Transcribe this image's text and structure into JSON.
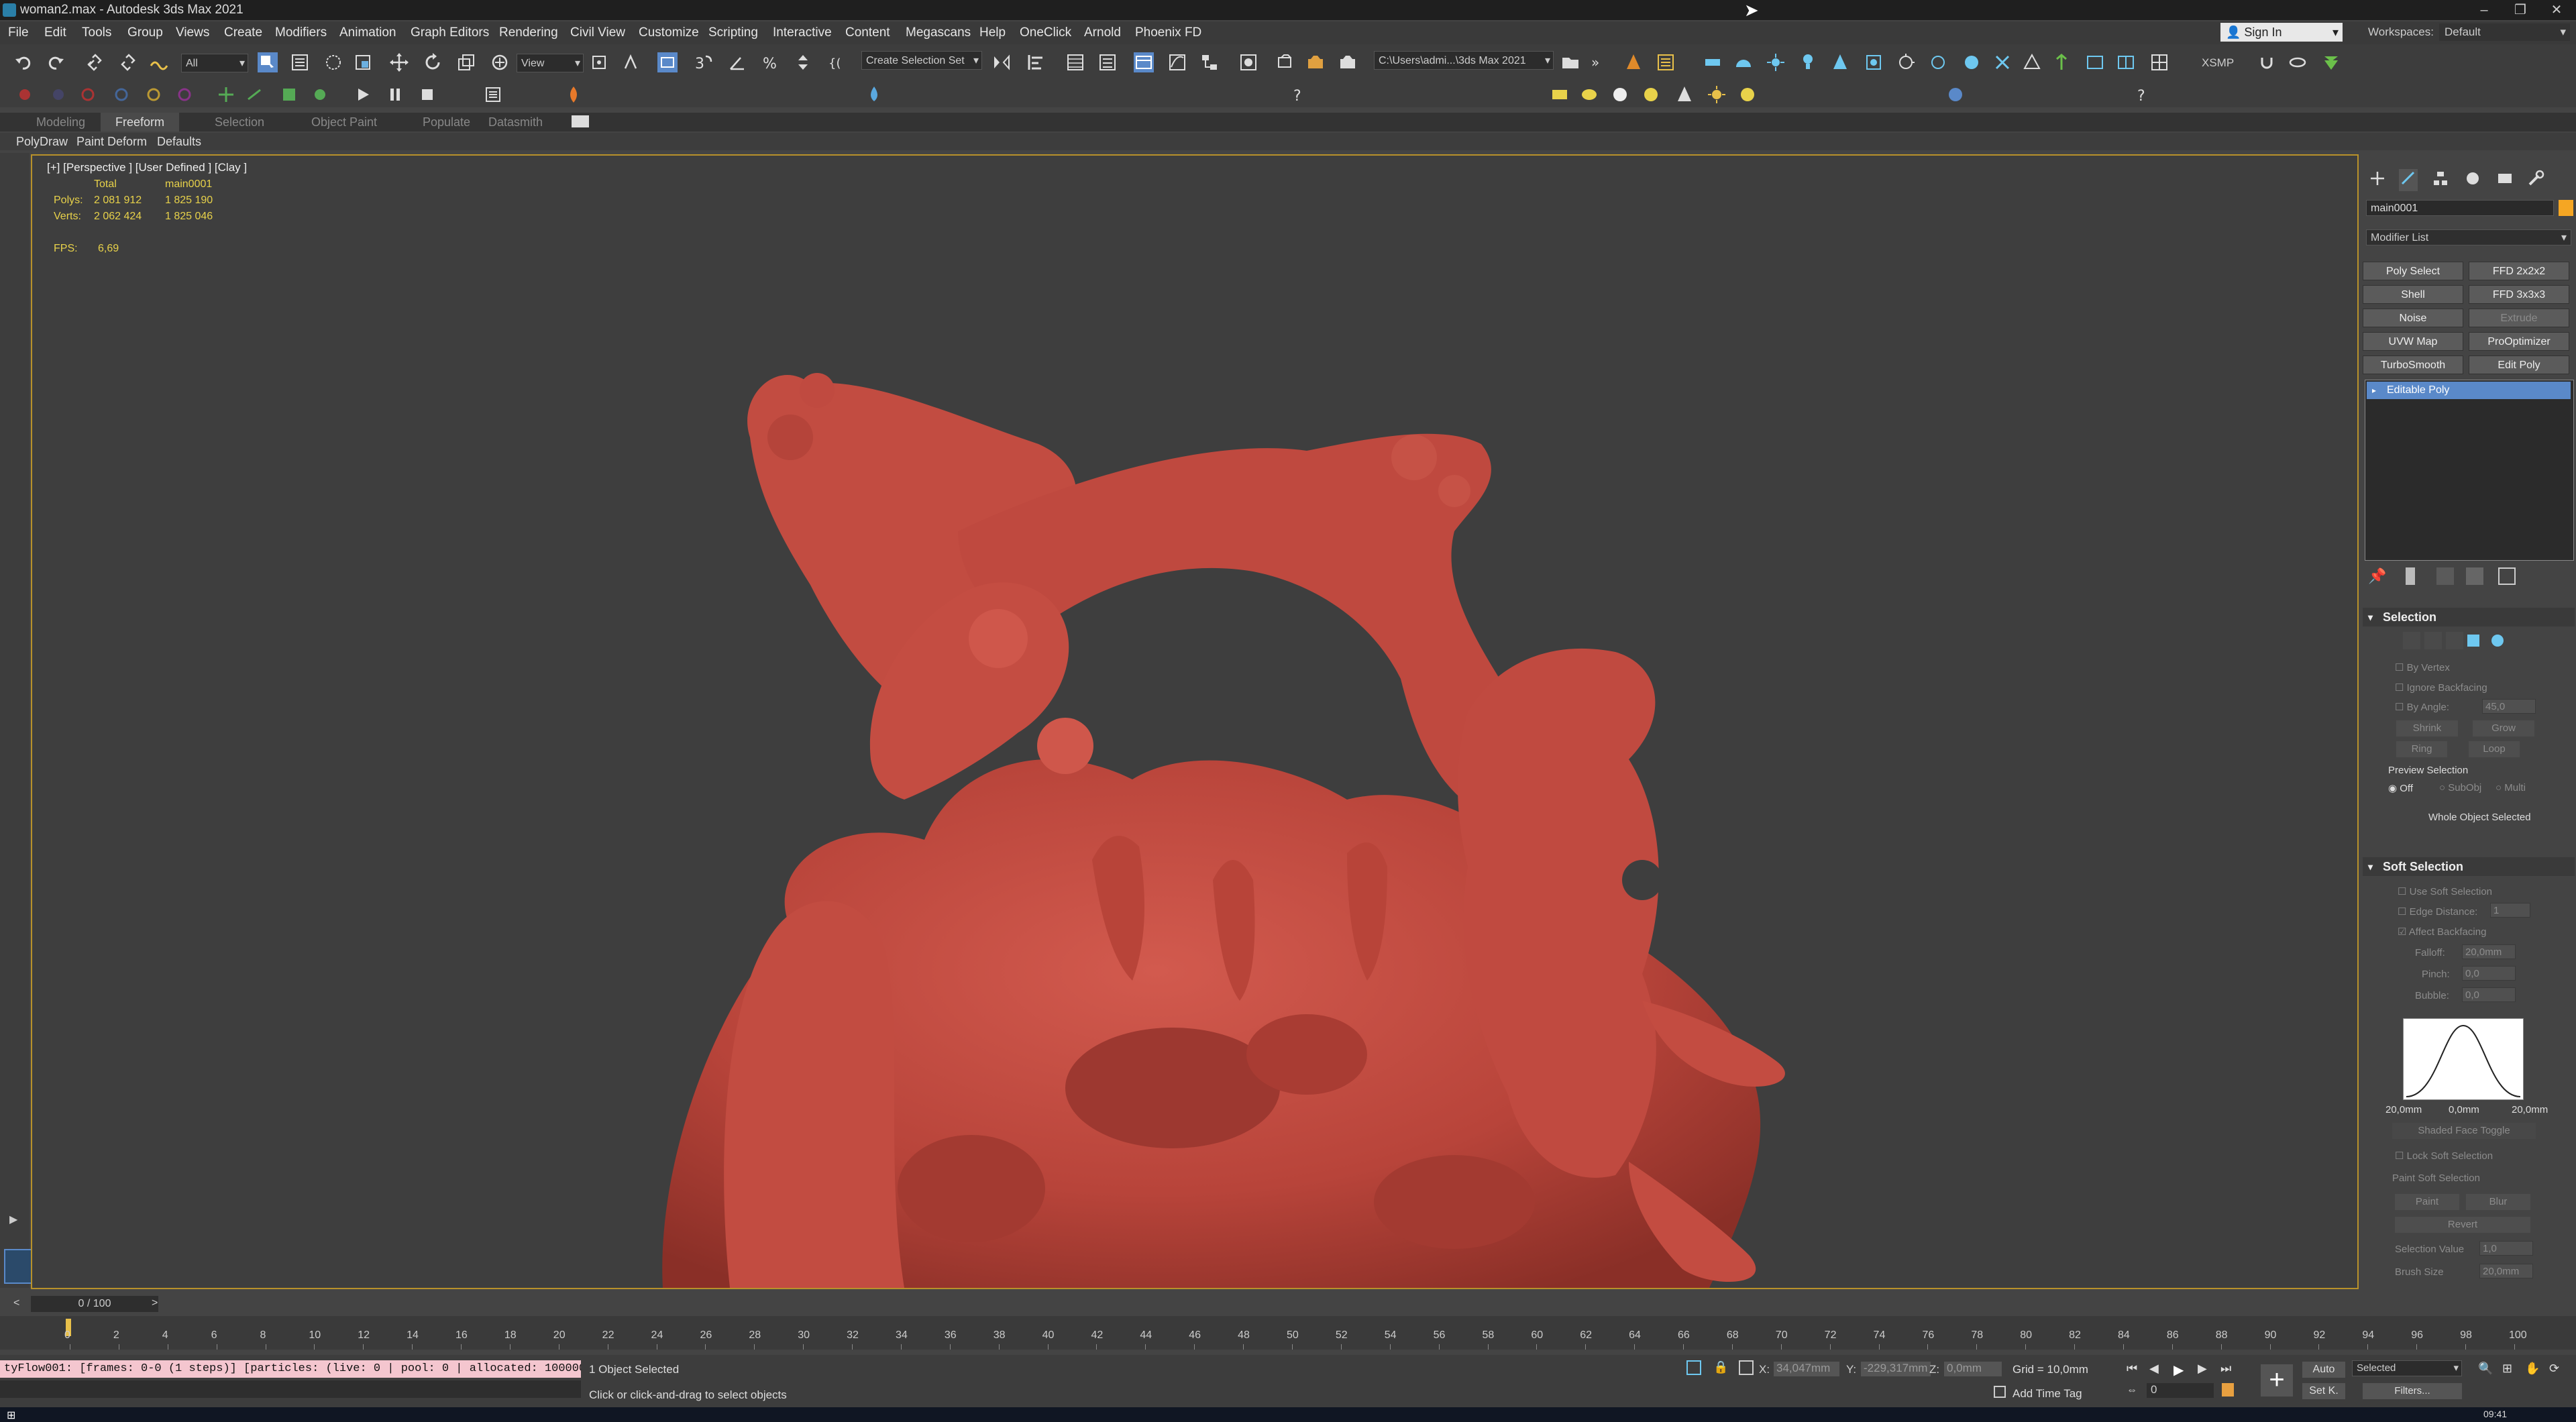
{
  "window": {
    "title": "woman2.max - Autodesk 3ds Max 2021",
    "minimize": "–",
    "maximize": "❐",
    "close": "✕"
  },
  "menu": [
    "File",
    "Edit",
    "Tools",
    "Group",
    "Views",
    "Create",
    "Modifiers",
    "Animation",
    "Graph Editors",
    "Rendering",
    "Civil View",
    "Customize",
    "Scripting",
    "Interactive",
    "Content",
    "Megascans",
    "Help",
    "OneClick",
    "Arnold",
    "Phoenix FD"
  ],
  "account": {
    "signin": "Sign In",
    "workspaces_label": "Workspaces:",
    "workspace": "Default"
  },
  "toolbar": {
    "filter": "All",
    "ref_coord": "View",
    "selection_set": "Create Selection Set",
    "path": "C:\\Users\\admi...\\3ds Max 2021",
    "xsmp": "XSMP"
  },
  "ribbon": {
    "tabs": [
      "Modeling",
      "Freeform",
      "Selection",
      "Object Paint",
      "Populate",
      "Datasmith"
    ],
    "active": "Freeform",
    "subtabs": [
      "PolyDraw",
      "Paint Deform",
      "Defaults"
    ]
  },
  "viewport": {
    "label": "[+] [Perspective ] [User Defined ] [Clay ]",
    "stats": {
      "col_total": "Total",
      "col_obj": "main0001",
      "polys_label": "Polys:",
      "polys_total": "2 081 912",
      "polys_obj": "1 825 190",
      "verts_label": "Verts:",
      "verts_total": "2 062 424",
      "verts_obj": "1 825 046",
      "fps_label": "FPS:",
      "fps": "6,69"
    },
    "sculpt_color": "#c0453c",
    "bg_color": "#3e3e3e",
    "border_color": "#b8912a"
  },
  "command_panel": {
    "object_name": "main0001",
    "modifier_list": "Modifier List",
    "modifier_buttons": [
      {
        "label": "Poly Select",
        "enabled": true
      },
      {
        "label": "FFD 2x2x2",
        "enabled": true
      },
      {
        "label": "Shell",
        "enabled": true
      },
      {
        "label": "FFD 3x3x3",
        "enabled": true
      },
      {
        "label": "Noise",
        "enabled": true
      },
      {
        "label": "Extrude",
        "enabled": false
      },
      {
        "label": "UVW Map",
        "enabled": true
      },
      {
        "label": "ProOptimizer",
        "enabled": true
      },
      {
        "label": "TurboSmooth",
        "enabled": true
      },
      {
        "label": "Edit Poly",
        "enabled": true
      }
    ],
    "stack_item": "Editable Poly",
    "selection": {
      "title": "Selection",
      "by_vertex": "By Vertex",
      "ignore_backfacing": "Ignore Backfacing",
      "by_angle": "By Angle:",
      "angle_value": "45,0",
      "shrink": "Shrink",
      "grow": "Grow",
      "ring": "Ring",
      "loop": "Loop",
      "preview_selection": "Preview Selection",
      "off": "Off",
      "subobj": "SubObj",
      "multi": "Multi",
      "whole_object": "Whole Object Selected"
    },
    "soft_selection": {
      "title": "Soft Selection",
      "use_soft": "Use Soft Selection",
      "edge_distance": "Edge Distance:",
      "edge_value": "1",
      "affect_backfacing": "Affect Backfacing",
      "falloff": "Falloff:",
      "falloff_value": "20,0mm",
      "pinch": "Pinch:",
      "pinch_value": "0,0",
      "bubble": "Bubble:",
      "bubble_value": "0,0",
      "curve_left": "20,0mm",
      "curve_mid": "0,0mm",
      "curve_right": "20,0mm",
      "shaded_face": "Shaded Face Toggle",
      "lock_soft": "Lock Soft Selection",
      "paint_soft": "Paint Soft Selection",
      "paint": "Paint",
      "blur": "Blur",
      "revert": "Revert",
      "selection_value": "Selection Value",
      "selection_value_num": "1,0",
      "brush_size": "Brush Size",
      "brush_size_val": "20,0mm"
    }
  },
  "timeline": {
    "frame": "0 / 100",
    "ticks": [
      "0",
      "2",
      "4",
      "6",
      "8",
      "10",
      "12",
      "14",
      "16",
      "18",
      "20",
      "22",
      "24",
      "26",
      "28",
      "30",
      "32",
      "34",
      "36",
      "38",
      "40",
      "42",
      "44",
      "46",
      "48",
      "50",
      "52",
      "54",
      "56",
      "58",
      "60",
      "62",
      "64",
      "66",
      "68",
      "70",
      "72",
      "74",
      "76",
      "78",
      "80",
      "82",
      "84",
      "86",
      "88",
      "90",
      "92",
      "94",
      "96",
      "98",
      "100"
    ]
  },
  "status": {
    "maxscript": "tyFlow001: [frames: 0-0 (1 steps)] [particles: (live: 0 | pool: 0 | allocated: 100000",
    "selected": "1 Object Selected",
    "prompt": "Click or click-and-drag to select objects",
    "x_label": "X:",
    "x_val": "34,047mm",
    "y_label": "Y:",
    "y_val": "-229,317mm",
    "z_label": "Z:",
    "z_val": "0,0mm",
    "grid": "Grid = 10,0mm",
    "add_time_tag": "Add Time Tag",
    "auto": "Auto",
    "set_k": "Set K.",
    "selected_dd": "Selected",
    "filters": "Filters...",
    "frame_field": "0",
    "clock": "09:41"
  }
}
